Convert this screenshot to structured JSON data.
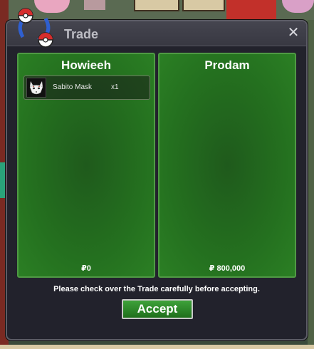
{
  "window": {
    "title": "Trade",
    "close_label": "✕"
  },
  "left_panel": {
    "player": "Howieeh",
    "items": [
      {
        "name": "Sabito Mask",
        "quantity": "x1",
        "icon": "white-fox-mask-icon"
      }
    ],
    "money": "₽0"
  },
  "right_panel": {
    "player": "Prodam",
    "items": [],
    "money": "₽ 800,000"
  },
  "notice": "Please check over the Trade carefully before accepting.",
  "accept_label": "Accept",
  "colors": {
    "panel_green": "#24701f",
    "window_bg": "#22222c",
    "title_text": "#bdbdc4",
    "accept_green": "#3ea23a"
  }
}
